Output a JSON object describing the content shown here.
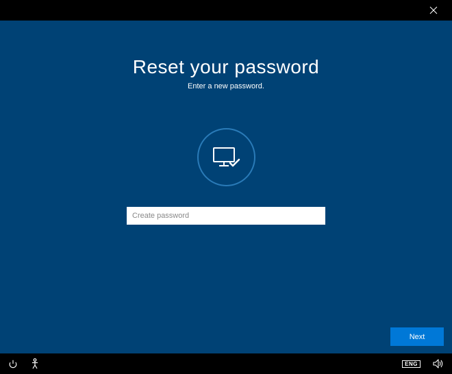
{
  "header": {
    "close_label": "Close"
  },
  "main": {
    "title": "Reset your password",
    "subtitle": "Enter a new password.",
    "password_placeholder": "Create password",
    "password_value": "",
    "next_label": "Next"
  },
  "footer": {
    "language_indicator": "ENG"
  }
}
